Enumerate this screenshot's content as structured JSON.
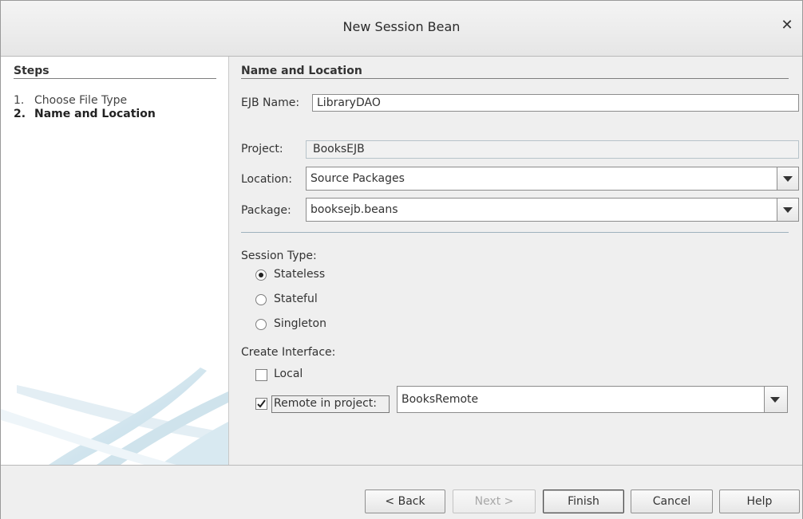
{
  "window": {
    "title": "New Session Bean",
    "close_icon": "close-icon"
  },
  "steps": {
    "title": "Steps",
    "items": [
      {
        "num": "1.",
        "label": "Choose File Type",
        "current": false
      },
      {
        "num": "2.",
        "label": "Name and Location",
        "current": true
      }
    ]
  },
  "form": {
    "section_title": "Name and Location",
    "ejb_name": {
      "label": "EJB Name:",
      "value": "LibraryDAO"
    },
    "project": {
      "label": "Project:",
      "value": "BooksEJB"
    },
    "location": {
      "label": "Location:",
      "value": "Source Packages"
    },
    "package": {
      "label": "Package:",
      "value": "booksejb.beans"
    },
    "session_type": {
      "label": "Session Type:",
      "options": [
        {
          "label": "Stateless",
          "checked": true
        },
        {
          "label": "Stateful",
          "checked": false
        },
        {
          "label": "Singleton",
          "checked": false
        }
      ]
    },
    "create_interface": {
      "label": "Create Interface:",
      "local": {
        "label": "Local",
        "checked": false
      },
      "remote": {
        "label": "Remote in project:",
        "checked": true,
        "project_value": "BooksRemote"
      }
    }
  },
  "buttons": {
    "back": "< Back",
    "next": "Next >",
    "finish": "Finish",
    "cancel": "Cancel",
    "help": "Help"
  }
}
